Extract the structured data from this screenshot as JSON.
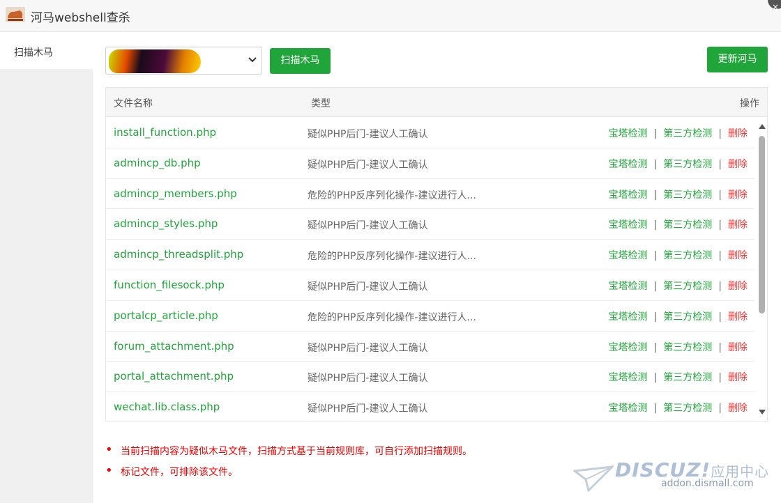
{
  "window": {
    "title": "河马webshell查杀",
    "close_glyph": "×"
  },
  "sidebar": {
    "items": [
      {
        "label": "扫描木马",
        "active": true
      }
    ]
  },
  "toolbar": {
    "directory_select_value": "",
    "scan_button": "扫描木马",
    "update_button": "更新河马"
  },
  "table": {
    "headers": {
      "name": "文件名称",
      "type": "类型",
      "action": "操作"
    },
    "actions": {
      "baota": "宝塔检测",
      "third": "第三方检测",
      "delete": "删除",
      "separator": "|"
    },
    "rows": [
      {
        "name": "install_function.php",
        "type": "疑似PHP后门-建议人工确认"
      },
      {
        "name": "admincp_db.php",
        "type": "疑似PHP后门-建议人工确认"
      },
      {
        "name": "admincp_members.php",
        "type": "危险的PHP反序列化操作-建议进行人..."
      },
      {
        "name": "admincp_styles.php",
        "type": "疑似PHP后门-建议人工确认"
      },
      {
        "name": "admincp_threadsplit.php",
        "type": "危险的PHP反序列化操作-建议进行人..."
      },
      {
        "name": "function_filesock.php",
        "type": "疑似PHP后门-建议人工确认"
      },
      {
        "name": "portalcp_article.php",
        "type": "危险的PHP反序列化操作-建议进行人..."
      },
      {
        "name": "forum_attachment.php",
        "type": "疑似PHP后门-建议人工确认"
      },
      {
        "name": "portal_attachment.php",
        "type": "疑似PHP后门-建议人工确认"
      },
      {
        "name": "wechat.lib.class.php",
        "type": "疑似PHP后门-建议人工确认"
      }
    ]
  },
  "notes": [
    "当前扫描内容为疑似木马文件，扫描方式基于当前规则库，可自行添加扫描规则。",
    "标记文件，可排除该文件。"
  ],
  "watermark": {
    "brand": "DISCUZ!",
    "brand_cn": "应用中心",
    "url": "addon.dismall.com"
  },
  "colors": {
    "accent": "#20a53a",
    "danger": "#ff3333",
    "note": "#ee0000"
  },
  "icons": {
    "logo": "hippo-logo-icon",
    "select": "chevron-down-icon",
    "scroll_up": "scroll-up-icon",
    "scroll_down": "scroll-down-icon"
  }
}
